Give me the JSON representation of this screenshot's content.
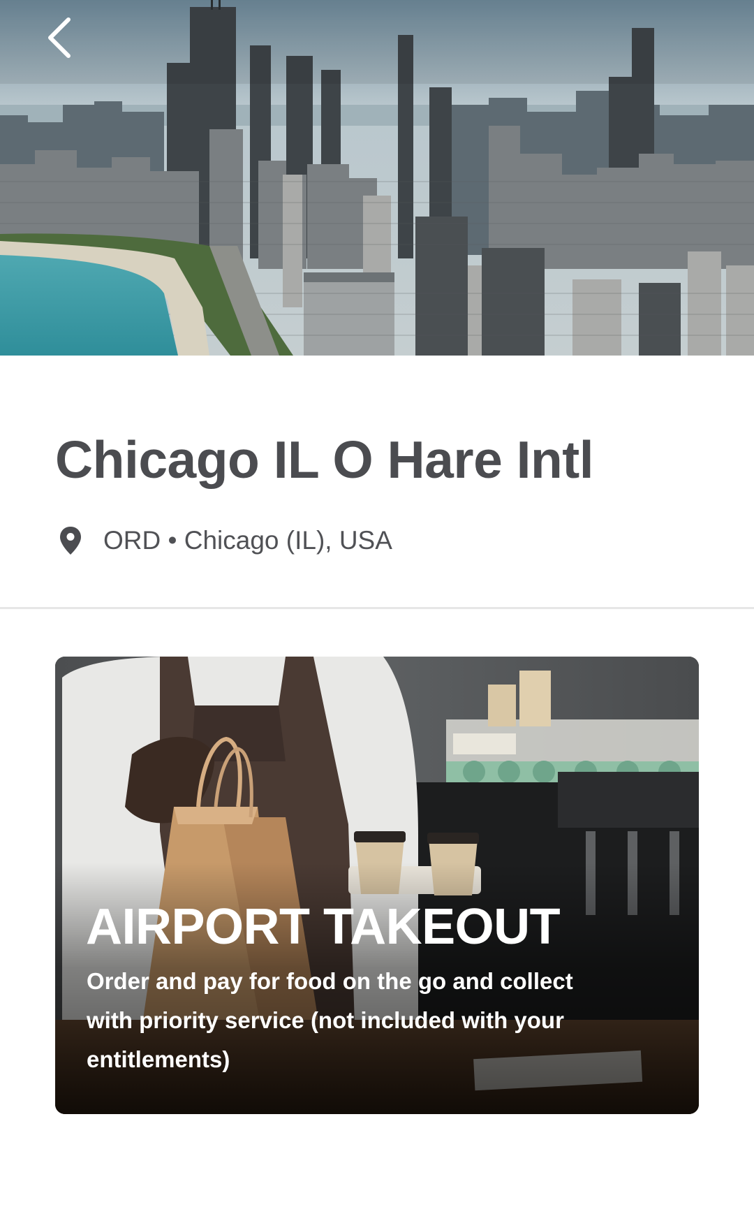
{
  "header": {
    "back_button_label": "Back",
    "hero_image": "chicago-skyline-lakefront"
  },
  "airport": {
    "name": "Chicago IL O Hare Intl",
    "location": "ORD • Chicago (IL), USA",
    "location_icon": "map-pin-icon"
  },
  "takeout_card": {
    "title": "AIRPORT TAKEOUT",
    "description": "Order and pay for food on the go and collect with priority service (not included with your entitlements)",
    "image": "barista-holding-takeout-bags-and-coffee"
  },
  "colors": {
    "title_text": "#4b4c50",
    "body_text": "#505155",
    "divider": "#e6e6e6",
    "card_text": "#ffffff"
  }
}
